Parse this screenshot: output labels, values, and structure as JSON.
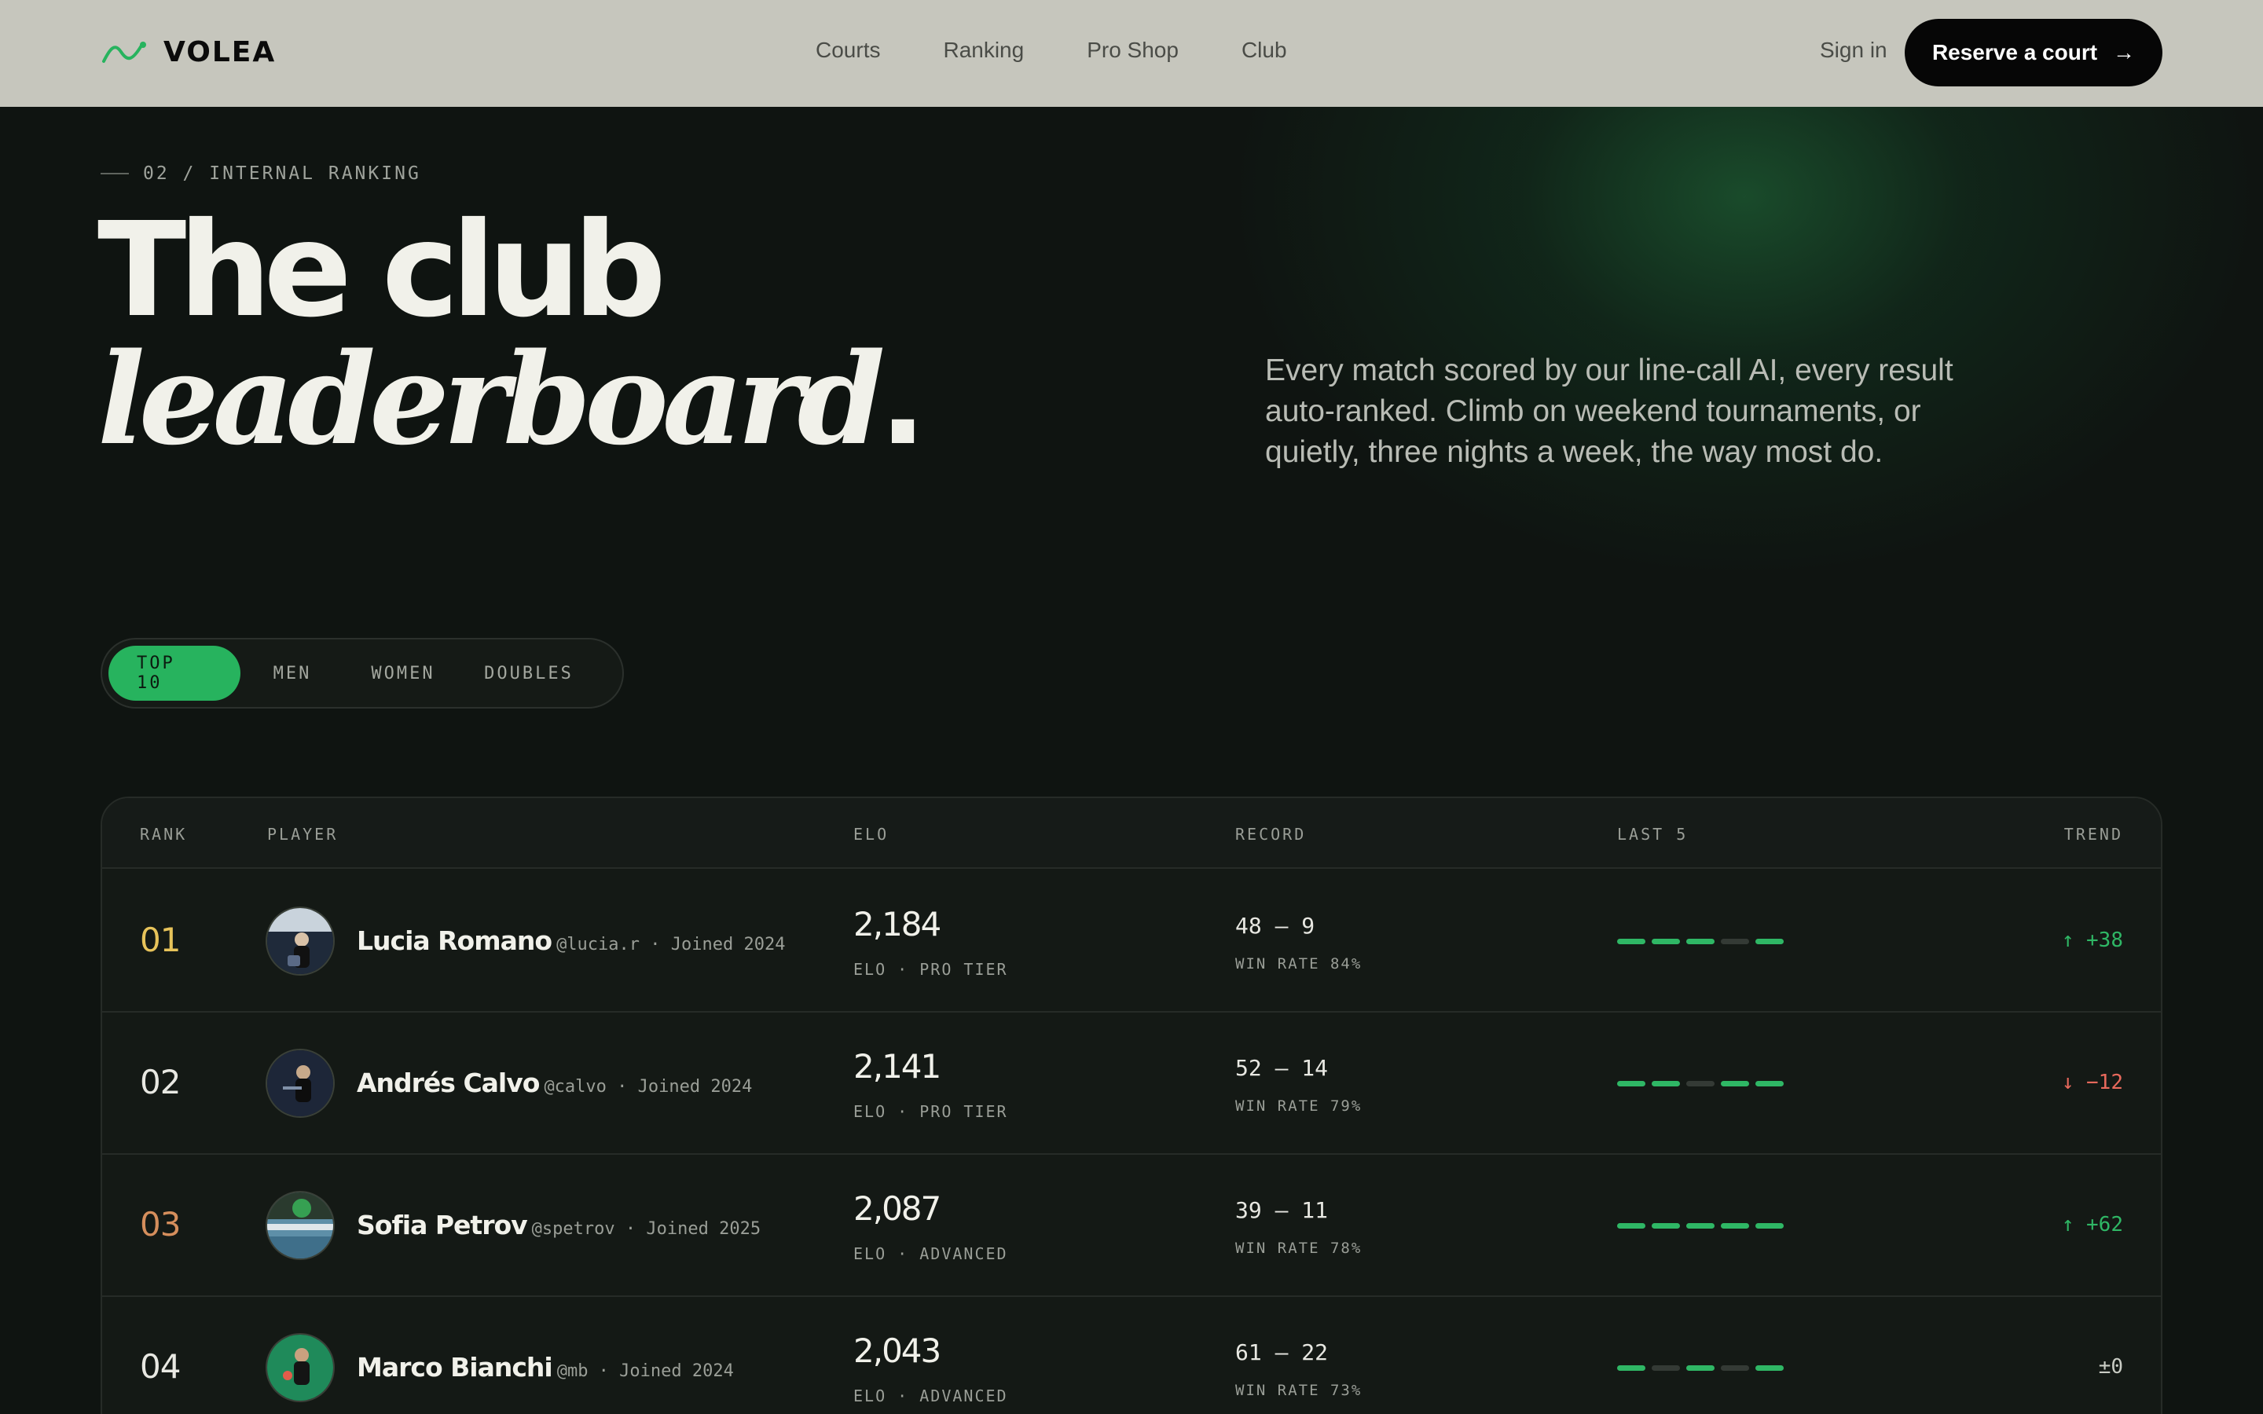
{
  "nav": {
    "brand": "VOLEA",
    "links": [
      "Courts",
      "Ranking",
      "Pro Shop",
      "Club"
    ],
    "sign_in": "Sign in",
    "cta": "Reserve a court",
    "accent": "#27b35e"
  },
  "hero": {
    "eyebrow": "02 / INTERNAL RANKING",
    "title_line1": "The club",
    "title_line2": "leaderboard",
    "title_dot": ".",
    "lede": "Every match scored by our line-call AI, every result auto-ranked. Climb on weekend tournaments, or quietly, three nights a week, the way most do."
  },
  "filters": {
    "tabs": [
      "TOP 10",
      "MEN",
      "WOMEN",
      "DOUBLES"
    ],
    "active": "TOP 10"
  },
  "table": {
    "headers": {
      "rank": "RANK",
      "player": "PLAYER",
      "elo": "ELO",
      "record": "RECORD",
      "last5": "LAST 5",
      "trend": "TREND"
    },
    "rows": [
      {
        "rank": "01",
        "rank_color": "#e7c35a",
        "name": "Lucia Romano",
        "handle": "@lucia.r · Joined 2024",
        "elo": "2,184",
        "elo_sub": "ELO · PRO TIER",
        "record": "48 — 9",
        "record_sub": "WIN RATE 84%",
        "last5": [
          "W",
          "W",
          "W",
          "L",
          "W"
        ],
        "trend": "↑ +38",
        "trend_dir": "up"
      },
      {
        "rank": "02",
        "rank_color": "#e8e8e2",
        "name": "Andrés Calvo",
        "handle": "@calvo · Joined 2024",
        "elo": "2,141",
        "elo_sub": "ELO · PRO TIER",
        "record": "52 — 14",
        "record_sub": "WIN RATE 79%",
        "last5": [
          "W",
          "W",
          "L",
          "W",
          "W"
        ],
        "trend": "↓ −12",
        "trend_dir": "down"
      },
      {
        "rank": "03",
        "rank_color": "#d58e5c",
        "name": "Sofia Petrov",
        "handle": "@spetrov · Joined 2025",
        "elo": "2,087",
        "elo_sub": "ELO · ADVANCED",
        "record": "39 — 11",
        "record_sub": "WIN RATE 78%",
        "last5": [
          "W",
          "W",
          "W",
          "W",
          "W"
        ],
        "trend": "↑ +62",
        "trend_dir": "up"
      },
      {
        "rank": "04",
        "rank_color": "#e8e8e2",
        "name": "Marco Bianchi",
        "handle": "@mb · Joined 2024",
        "elo": "2,043",
        "elo_sub": "ELO · ADVANCED",
        "record": "61 — 22",
        "record_sub": "WIN RATE 73%",
        "last5": [
          "W",
          "L",
          "W",
          "L",
          "W"
        ],
        "trend": "±0",
        "trend_dir": "flat"
      }
    ]
  }
}
